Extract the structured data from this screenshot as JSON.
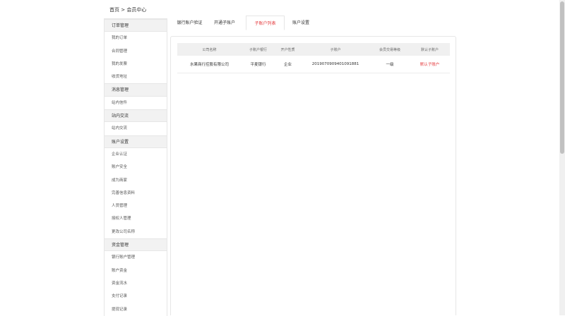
{
  "breadcrumb": "首页 > 会员中心",
  "sidebar": {
    "rows": [
      {
        "label": "订单管理",
        "type": "header",
        "name": "sidebar-section-orders"
      },
      {
        "label": "我的订单",
        "type": "item",
        "name": "sidebar-item-my-orders"
      },
      {
        "label": "合同管理",
        "type": "item",
        "name": "sidebar-item-contracts"
      },
      {
        "label": "我的发票",
        "type": "item",
        "name": "sidebar-item-my-invoices"
      },
      {
        "label": "收货地址",
        "type": "item",
        "name": "sidebar-item-shipping-address"
      },
      {
        "label": "消息管理",
        "type": "header",
        "name": "sidebar-section-messages"
      },
      {
        "label": "站内信件",
        "type": "item",
        "name": "sidebar-item-site-mail"
      },
      {
        "label": "站内交流",
        "type": "header",
        "name": "sidebar-section-communication"
      },
      {
        "label": "站内交流",
        "type": "item",
        "name": "sidebar-item-site-communication"
      },
      {
        "label": "账户设置",
        "type": "header",
        "name": "sidebar-section-account"
      },
      {
        "label": "企业认证",
        "type": "item",
        "name": "sidebar-item-enterprise-cert"
      },
      {
        "label": "账户安全",
        "type": "item",
        "name": "sidebar-item-account-security"
      },
      {
        "label": "成为商家",
        "type": "item",
        "name": "sidebar-item-become-merchant"
      },
      {
        "label": "完善信息资料",
        "type": "item",
        "name": "sidebar-item-complete-info"
      },
      {
        "label": "人员管理",
        "type": "item",
        "name": "sidebar-item-staff"
      },
      {
        "label": "授权人管理",
        "type": "item",
        "name": "sidebar-item-authorized"
      },
      {
        "label": "更改公司名称",
        "type": "item",
        "name": "sidebar-item-change-company-name"
      },
      {
        "label": "资金管理",
        "type": "header",
        "name": "sidebar-section-funds"
      },
      {
        "label": "银行账户管理",
        "type": "item",
        "name": "sidebar-item-bank-accounts"
      },
      {
        "label": "账户资金",
        "type": "item",
        "name": "sidebar-item-account-funds"
      },
      {
        "label": "资金流水",
        "type": "item",
        "name": "sidebar-item-fund-flow"
      },
      {
        "label": "支付记录",
        "type": "item",
        "name": "sidebar-item-payment-records"
      },
      {
        "label": "提现记录",
        "type": "item",
        "name": "sidebar-item-withdraw-records"
      }
    ]
  },
  "tabs": [
    {
      "label": "银行账户验证",
      "active": false,
      "name": "tab-bank-verify"
    },
    {
      "label": "开通子账户",
      "active": false,
      "name": "tab-open-subaccount"
    },
    {
      "label": "子账户列表",
      "active": true,
      "name": "tab-subaccount-list"
    },
    {
      "label": "账户设置",
      "active": false,
      "name": "tab-account-settings"
    }
  ],
  "table": {
    "headers": [
      "公司名称",
      "子账户银行",
      "开户性质",
      "子账户",
      "会员交易等级",
      "默认子账户"
    ],
    "rows": [
      [
        "水果商行控股有限公司",
        "平麦银行",
        "企业",
        "2019070909401091881",
        "一级",
        "默认子账户"
      ]
    ]
  },
  "colors": {
    "accent": "#e4393c",
    "header_bg": "#f2f2f2",
    "border": "#e6e6e6"
  }
}
